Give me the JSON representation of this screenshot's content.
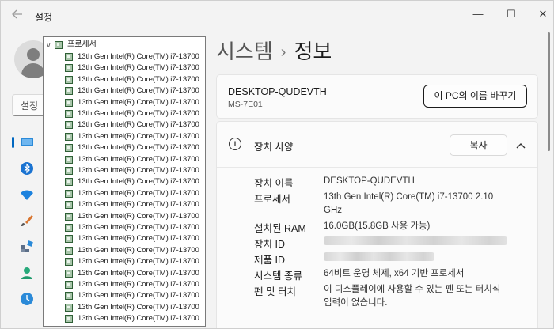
{
  "window": {
    "app_title": "설정",
    "controls": {
      "minimize": "—",
      "maximize": "☐",
      "close": "✕"
    }
  },
  "nav": {
    "search_label": "설정",
    "icons": [
      "display-icon",
      "bluetooth-icon",
      "wifi-icon",
      "brush-icon",
      "apps-icon",
      "accounts-icon",
      "time-language-icon"
    ]
  },
  "tree": {
    "header": "프로세서",
    "items": [
      "13th Gen Intel(R) Core(TM) i7-13700",
      "13th Gen Intel(R) Core(TM) i7-13700",
      "13th Gen Intel(R) Core(TM) i7-13700",
      "13th Gen Intel(R) Core(TM) i7-13700",
      "13th Gen Intel(R) Core(TM) i7-13700",
      "13th Gen Intel(R) Core(TM) i7-13700",
      "13th Gen Intel(R) Core(TM) i7-13700",
      "13th Gen Intel(R) Core(TM) i7-13700",
      "13th Gen Intel(R) Core(TM) i7-13700",
      "13th Gen Intel(R) Core(TM) i7-13700",
      "13th Gen Intel(R) Core(TM) i7-13700",
      "13th Gen Intel(R) Core(TM) i7-13700",
      "13th Gen Intel(R) Core(TM) i7-13700",
      "13th Gen Intel(R) Core(TM) i7-13700",
      "13th Gen Intel(R) Core(TM) i7-13700",
      "13th Gen Intel(R) Core(TM) i7-13700",
      "13th Gen Intel(R) Core(TM) i7-13700",
      "13th Gen Intel(R) Core(TM) i7-13700",
      "13th Gen Intel(R) Core(TM) i7-13700",
      "13th Gen Intel(R) Core(TM) i7-13700",
      "13th Gen Intel(R) Core(TM) i7-13700",
      "13th Gen Intel(R) Core(TM) i7-13700",
      "13th Gen Intel(R) Core(TM) i7-13700",
      "13th Gen Intel(R) Core(TM) i7-13700"
    ]
  },
  "breadcrumb": {
    "parent": "시스템",
    "separator": "›",
    "current": "정보"
  },
  "device": {
    "name": "DESKTOP-QUDEVTH",
    "model": "MS-7E01",
    "rename_button": "이 PC의 이름 바꾸기"
  },
  "specs": {
    "title": "장치 사양",
    "copy_button": "복사",
    "rows": {
      "device_name": {
        "label": "장치 이름",
        "value": "DESKTOP-QUDEVTH"
      },
      "processor": {
        "label": "프로세서",
        "value": "13th Gen Intel(R) Core(TM) i7-13700   2.10 GHz"
      },
      "ram": {
        "label": "설치된 RAM",
        "value": "16.0GB(15.8GB 사용 가능)"
      },
      "device_id": {
        "label": "장치 ID"
      },
      "product_id": {
        "label": "제품 ID"
      },
      "system_type": {
        "label": "시스템 종류",
        "value": "64비트 운영 체제, x64 기반 프로세서"
      },
      "pen_touch": {
        "label": "펜 및 터치",
        "value": "이 디스플레이에 사용할 수 있는 펜 또는 터치식 입력이 없습니다."
      }
    }
  },
  "colors": {
    "accent": "#0067c0",
    "chip": "#a9c6ab"
  }
}
